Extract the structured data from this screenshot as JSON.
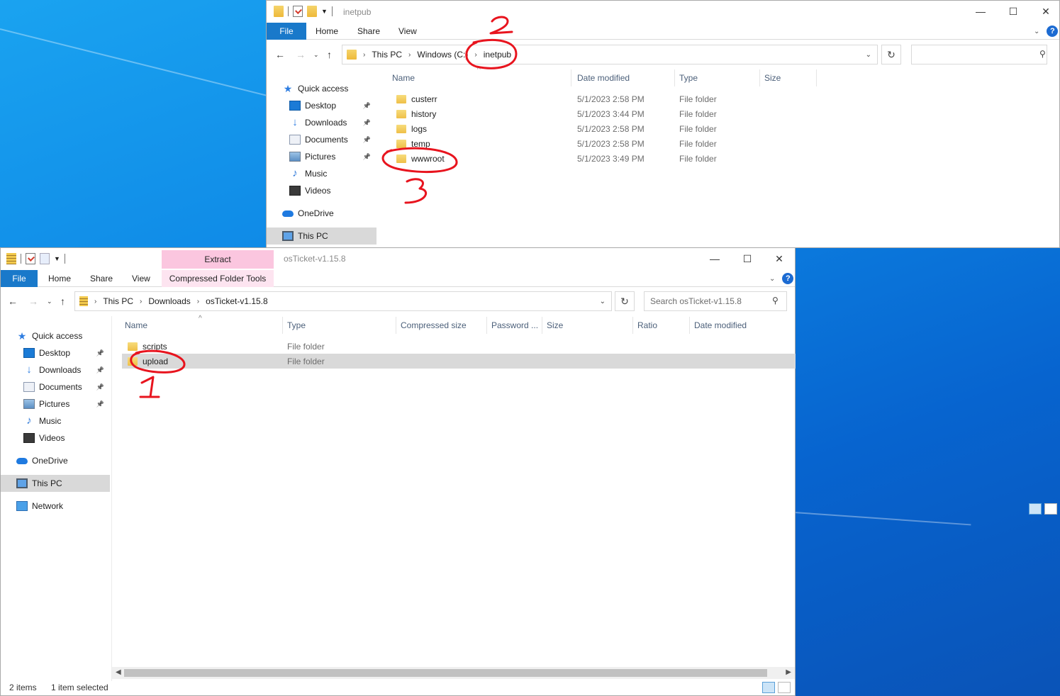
{
  "window_back": {
    "title": "inetpub",
    "ribbon_tabs": [
      "File",
      "Home",
      "Share",
      "View"
    ],
    "address": [
      "This PC",
      "Windows (C:)",
      "inetpub"
    ],
    "search_placeholder": "",
    "nav": [
      {
        "label": "Quick access",
        "icon": "star-icon"
      },
      {
        "label": "Desktop",
        "icon": "desktop-icon",
        "pinned": true
      },
      {
        "label": "Downloads",
        "icon": "download-icon",
        "pinned": true
      },
      {
        "label": "Documents",
        "icon": "documents-icon",
        "pinned": true
      },
      {
        "label": "Pictures",
        "icon": "pictures-icon",
        "pinned": true
      },
      {
        "label": "Music",
        "icon": "music-icon"
      },
      {
        "label": "Videos",
        "icon": "videos-icon"
      },
      {
        "label": "OneDrive",
        "icon": "cloud-icon"
      },
      {
        "label": "This PC",
        "icon": "computer-icon",
        "selected": true
      }
    ],
    "columns": [
      "Name",
      "Date modified",
      "Type",
      "Size"
    ],
    "files": [
      {
        "name": "custerr",
        "date": "5/1/2023 2:58 PM",
        "type": "File folder"
      },
      {
        "name": "history",
        "date": "5/1/2023 3:44 PM",
        "type": "File folder"
      },
      {
        "name": "logs",
        "date": "5/1/2023 2:58 PM",
        "type": "File folder"
      },
      {
        "name": "temp",
        "date": "5/1/2023 2:58 PM",
        "type": "File folder"
      },
      {
        "name": "wwwroot",
        "date": "5/1/2023 3:49 PM",
        "type": "File folder"
      }
    ]
  },
  "window_front": {
    "title": "osTicket-v1.15.8",
    "ribbon_tabs": [
      "File",
      "Home",
      "Share",
      "View"
    ],
    "context_tab_group": "Extract",
    "context_tab": "Compressed Folder Tools",
    "address": [
      "This PC",
      "Downloads",
      "osTicket-v1.15.8"
    ],
    "search_placeholder": "Search osTicket-v1.15.8",
    "nav": [
      {
        "label": "Quick access",
        "icon": "star-icon"
      },
      {
        "label": "Desktop",
        "icon": "desktop-icon",
        "pinned": true
      },
      {
        "label": "Downloads",
        "icon": "download-icon",
        "pinned": true
      },
      {
        "label": "Documents",
        "icon": "documents-icon",
        "pinned": true
      },
      {
        "label": "Pictures",
        "icon": "pictures-icon",
        "pinned": true
      },
      {
        "label": "Music",
        "icon": "music-icon"
      },
      {
        "label": "Videos",
        "icon": "videos-icon"
      },
      {
        "label": "OneDrive",
        "icon": "cloud-icon"
      },
      {
        "label": "This PC",
        "icon": "computer-icon",
        "selected": true
      },
      {
        "label": "Network",
        "icon": "network-icon"
      }
    ],
    "columns": [
      "Name",
      "Type",
      "Compressed size",
      "Password ...",
      "Size",
      "Ratio",
      "Date modified"
    ],
    "files": [
      {
        "name": "scripts",
        "type": "File folder"
      },
      {
        "name": "upload",
        "type": "File folder",
        "selected": true
      }
    ],
    "status": {
      "count": "2 items",
      "selection": "1 item selected"
    }
  },
  "annotations": [
    {
      "label": "1",
      "color": "#e8141e"
    },
    {
      "label": "2",
      "color": "#e8141e"
    },
    {
      "label": "3",
      "color": "#e8141e"
    }
  ]
}
